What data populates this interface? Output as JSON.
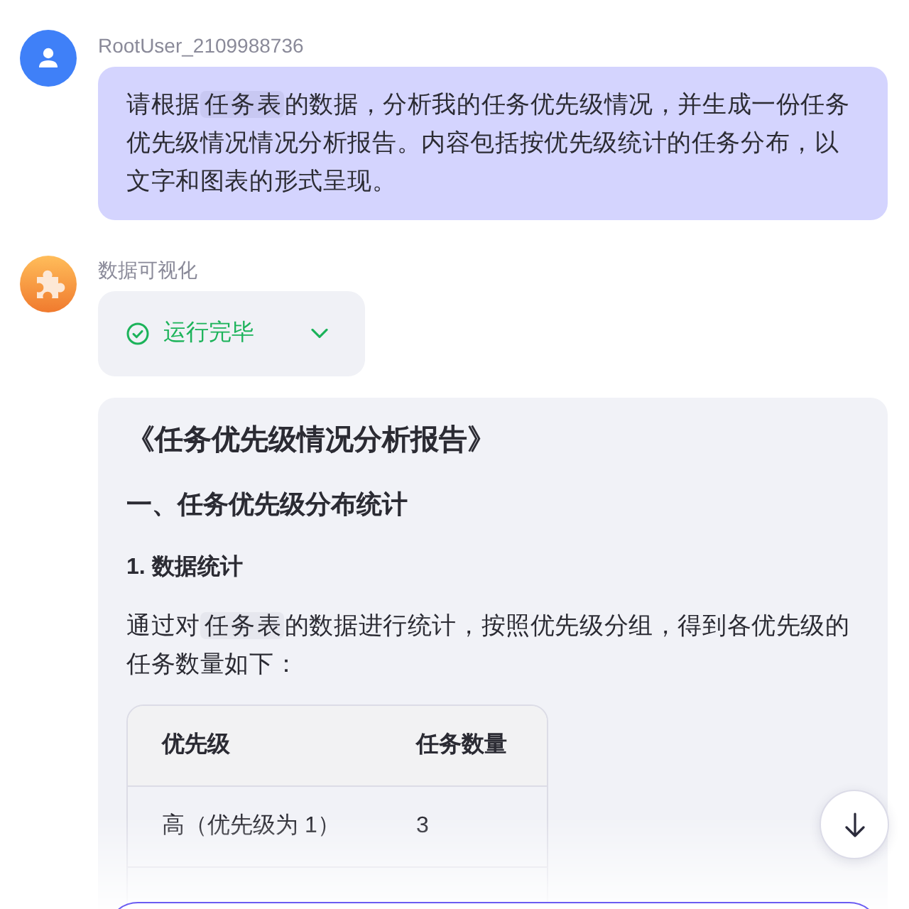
{
  "user_message": {
    "author": "RootUser_2109988736",
    "text_before": "请根据",
    "reference": "任务表",
    "text_after": "的数据，分析我的任务优先级情况，并生成一份任务优先级情况情况分析报告。内容包括按优先级统计的任务分布，以文字和图表的形式呈现。"
  },
  "assistant_message": {
    "author": "数据可视化",
    "run_status": {
      "label": "运行完毕",
      "kind": "success",
      "expanded": false
    },
    "report": {
      "title": "《任务优先级情况分析报告》",
      "section_heading": "一、任务优先级分布统计",
      "subsection_heading": "1. 数据统计",
      "paragraph": {
        "text_before": "通过对",
        "reference": "任务表",
        "text_after": "的数据进行统计，按照优先级分组，得到各优先级的任务数量如下："
      },
      "table": {
        "columns": [
          "优先级",
          "任务数量"
        ],
        "rows": [
          [
            "高（优先级为 1）",
            "3"
          ]
        ]
      }
    }
  }
}
